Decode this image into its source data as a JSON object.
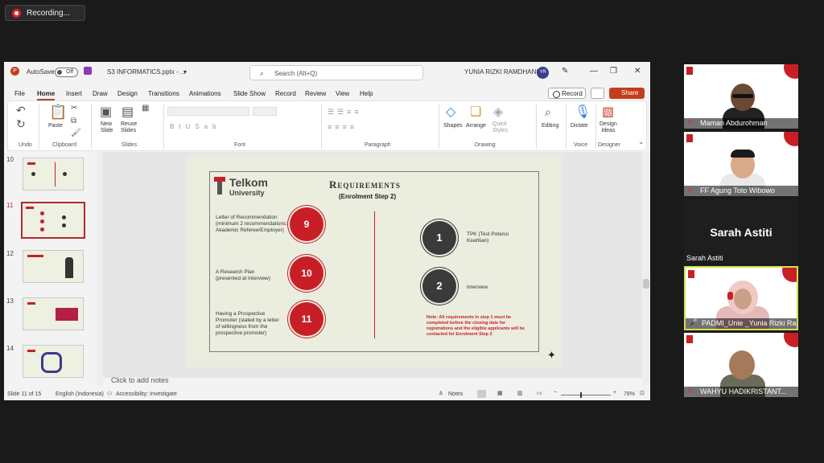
{
  "recording": {
    "label": "Recording..."
  },
  "titlebar": {
    "autosave": "AutoSave",
    "toggle": "Off",
    "filename": "S3 INFORMATICS.pptx  -  ...",
    "search": "Search (Alt+Q)",
    "user": "YUNIA RIZKI RAMDHANI",
    "initials": "YR"
  },
  "menu": [
    "File",
    "Home",
    "Insert",
    "Draw",
    "Design",
    "Transitions",
    "Animations",
    "Slide Show",
    "Record",
    "Review",
    "View",
    "Help"
  ],
  "buttons": {
    "record": "Record",
    "share": "Share"
  },
  "ribbon": {
    "undo": "Undo",
    "clipboard": "Clipboard",
    "paste": "Paste",
    "new_slide": "New\nSlide",
    "reuse": "Reuse\nSlides",
    "slides": "Slides",
    "font": "Font",
    "paragraph": "Paragraph",
    "shapes": "Shapes",
    "arrange": "Arrange",
    "quick": "Quick\nStyles",
    "drawing": "Drawing",
    "editing": "Editing",
    "dictate": "Dictate",
    "voice": "Voice",
    "design_ideas": "Design\nIdeas",
    "designer": "Designer"
  },
  "thumbs": [
    "10",
    "11",
    "12",
    "13",
    "14"
  ],
  "slide": {
    "logo": "Telkom",
    "logo_sub": "University",
    "title": "Requirements",
    "subtitle": "(Enrolment Step 2)",
    "left": [
      {
        "num": "9",
        "text": "Letter of Recommendation (minimum 2 recommendations: Akademic Referee/Employer)"
      },
      {
        "num": "10",
        "text": "A Research Plan (presented at interview)"
      },
      {
        "num": "11",
        "text": "Having a Prospective Promoter (stated by a letter of willingness from the prospective promoter)"
      }
    ],
    "right": [
      {
        "num": "1",
        "text": "TPK (Test Potensi Keahlian)"
      },
      {
        "num": "2",
        "text": "Interview"
      }
    ],
    "note": "Note: All requirements in step 1 must be completed before the closing date for registrations and the eligible applicants will be contacted for Enrolment Step 2"
  },
  "notes_placeholder": "Click to add notes",
  "status": {
    "slide": "Slide 11 of 15",
    "lang": "English (Indonesia)",
    "access": "Accessibility: Investigate",
    "notes": "Notes",
    "zoom": "78%"
  },
  "participants": [
    {
      "name": "Maman Abdurohman"
    },
    {
      "name": "FF Agung Toto Wibowo"
    },
    {
      "big": "Sarah Astiti",
      "name": "Sarah Astiti"
    },
    {
      "name": "PADMI_Unie _Yunia Rizki Ra..."
    },
    {
      "name": "WAHYU HADIKRISTANT..."
    }
  ],
  "colors": {
    "accent": "#c43e1c",
    "telkom_red": "#c81f27",
    "speaker_border": "#d4e04a"
  }
}
